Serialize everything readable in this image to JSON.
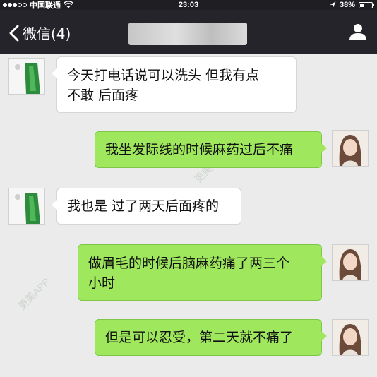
{
  "status_bar": {
    "carrier": "中国联通",
    "time": "23:03",
    "battery": "38%",
    "battery_level": 0.38
  },
  "nav": {
    "back_label": "微信(4)",
    "back_icon": "chevron-left-icon",
    "contact_icon": "person-icon"
  },
  "messages": [
    {
      "side": "left",
      "lines": [
        "今天打电话说可以洗头 但我有点",
        "不敢 后面疼"
      ]
    },
    {
      "side": "right",
      "lines": [
        "我坐发际线的时候麻药过后不痛"
      ]
    },
    {
      "side": "left",
      "lines": [
        "我也是 过了两天后面疼的"
      ]
    },
    {
      "side": "right",
      "lines": [
        "做眉毛的时候后脑麻药痛了两三个",
        "小时"
      ]
    },
    {
      "side": "right",
      "lines": [
        "但是可以忍受，第二天就不痛了"
      ]
    }
  ],
  "watermark": "更美APP",
  "colors": {
    "nav_bg": "#24242a",
    "chat_bg": "#ebebeb",
    "green_bubble": "#9fe75c",
    "white_bubble": "#ffffff"
  }
}
